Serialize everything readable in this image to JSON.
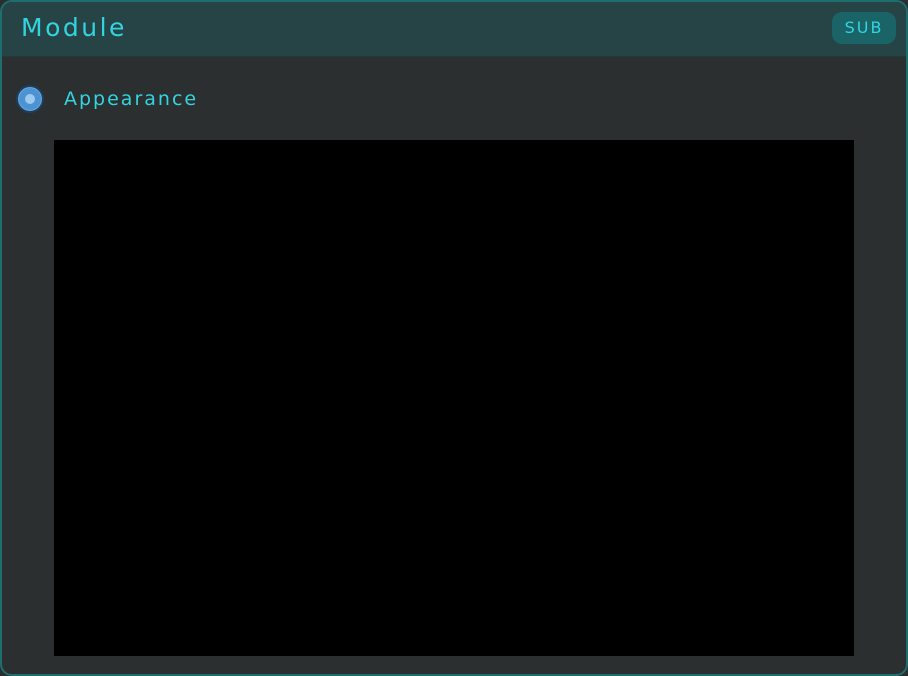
{
  "window": {
    "title": "Module",
    "badge_label": "SUB"
  },
  "options": [
    {
      "label": "Appearance",
      "selected": true
    }
  ],
  "colors": {
    "accent": "#33d4e0",
    "titlebar": "#264446",
    "background": "#2b2f30",
    "border": "#1e6e70",
    "radio": "#4e93d1",
    "viewport": "#000000"
  }
}
